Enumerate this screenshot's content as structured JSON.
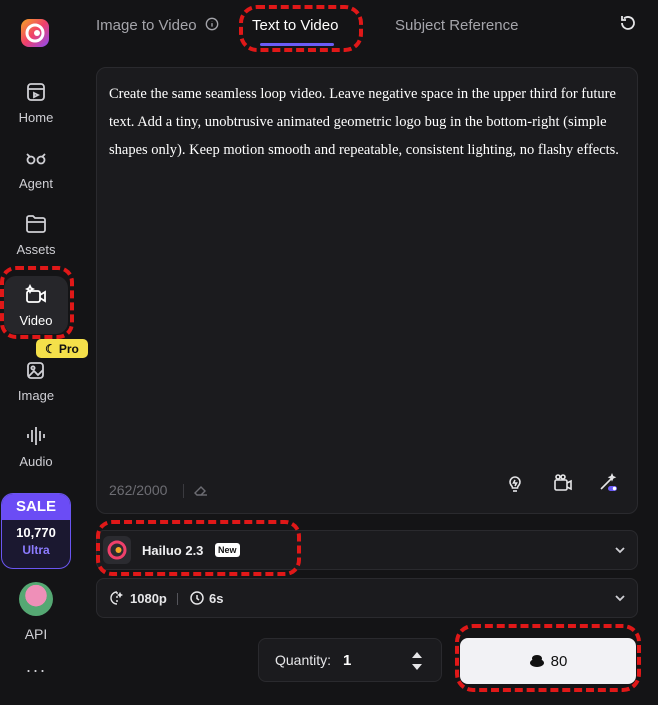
{
  "sidebar": {
    "items": [
      {
        "label": "Home",
        "icon": "home-icon"
      },
      {
        "label": "Agent",
        "icon": "agent-icon"
      },
      {
        "label": "Assets",
        "icon": "folder-icon"
      },
      {
        "label": "Video",
        "icon": "video-icon"
      },
      {
        "label": "Image",
        "icon": "image-icon"
      },
      {
        "label": "Audio",
        "icon": "audio-icon"
      }
    ],
    "pro_badge": "Pro",
    "sale": {
      "title": "SALE",
      "amount": "10,770",
      "plan": "Ultra"
    },
    "api_label": "API",
    "more_label": "···"
  },
  "tabs": [
    {
      "label": "Image to Video"
    },
    {
      "label": "Text to Video"
    },
    {
      "label": "Subject Reference"
    }
  ],
  "prompt": {
    "text": "Create the same seamless loop video. Leave negative space in the upper third for future text. Add a tiny, unobtrusive animated geometric logo bug in the bottom-right (simple shapes only). Keep motion smooth and repeatable, consistent lighting, no flashy effects.",
    "char_count": "262/2000"
  },
  "model": {
    "name": "Hailuo 2.3",
    "badge": "New"
  },
  "settings": {
    "resolution": "1080p",
    "duration": "6s"
  },
  "quantity": {
    "label": "Quantity:",
    "value": "1"
  },
  "generate": {
    "cost": "80"
  },
  "colors": {
    "accent": "#6b5cf5",
    "highlight": "#e01818",
    "background": "#141416",
    "panel": "#1b1b1e"
  }
}
